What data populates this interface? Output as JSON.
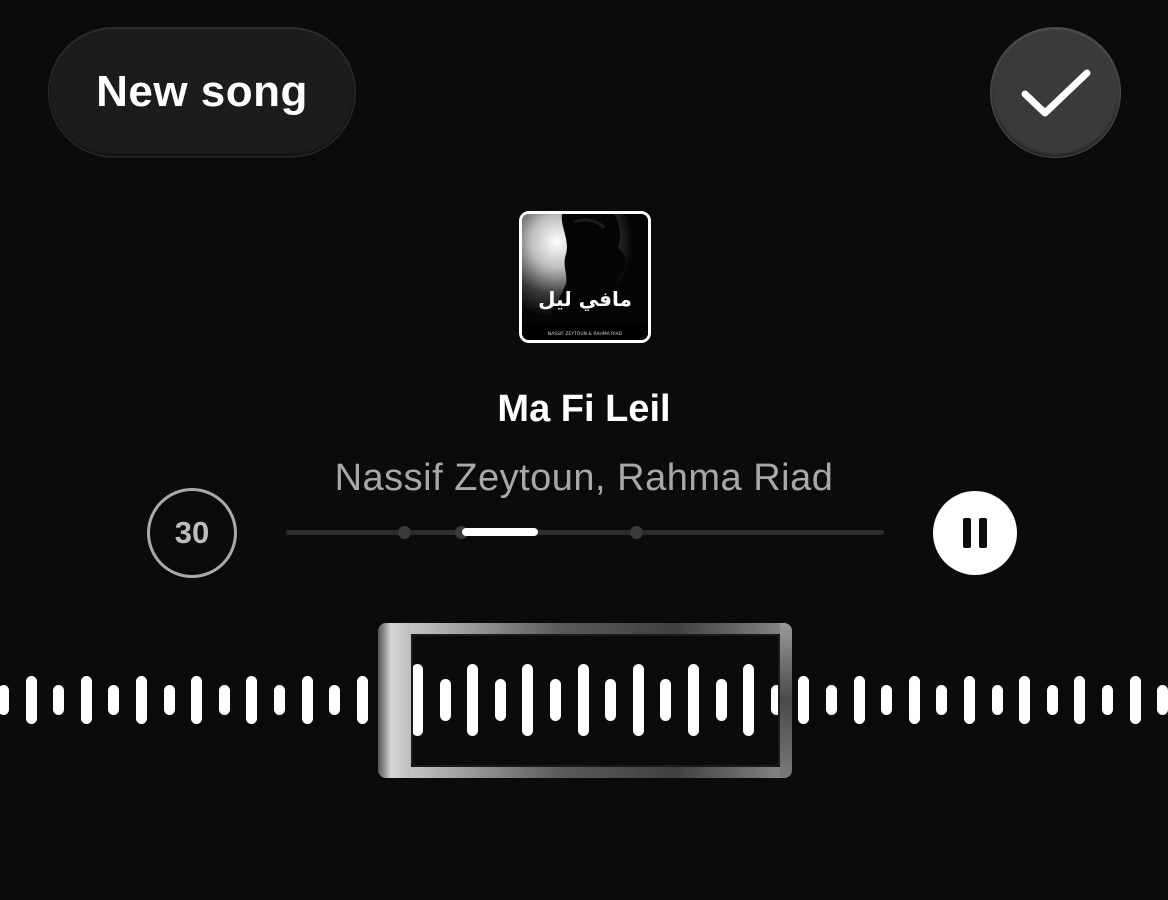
{
  "header": {
    "new_song_label": "New song",
    "done_icon": "checkmark-icon"
  },
  "track": {
    "title": "Ma Fi Leil",
    "artist": "Nassif Zeytoun, Rahma Riad",
    "artwork_text": "مافي ليل",
    "artwork_caption": "NASSIF ZEYTOUN & RAHMA RIAD"
  },
  "controls": {
    "clip_duration": "30",
    "pause_icon": "pause-icon"
  },
  "colors": {
    "background": "#0b0b0b",
    "primary_text": "#ffffff",
    "secondary_text": "#a8a8a8",
    "accent": "#ffffff"
  }
}
